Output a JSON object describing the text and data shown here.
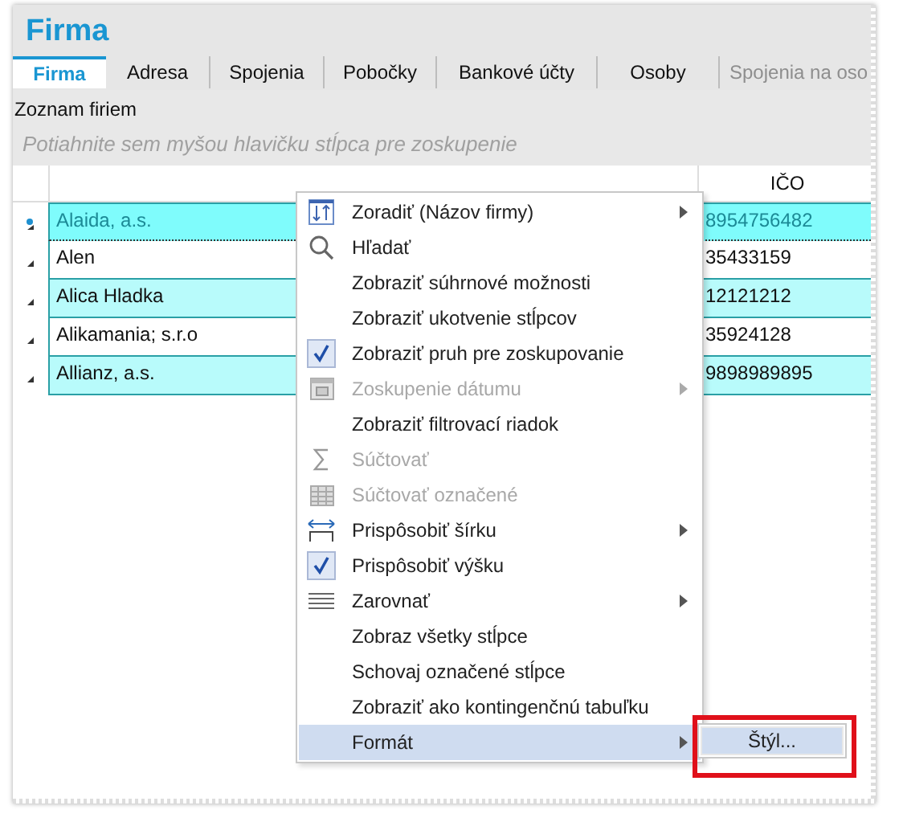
{
  "window": {
    "title": "Firma"
  },
  "tabs": [
    {
      "label": "Firma",
      "selected": true,
      "disabled": false
    },
    {
      "label": "Adresa",
      "selected": false,
      "disabled": false
    },
    {
      "label": "Spojenia",
      "selected": false,
      "disabled": false
    },
    {
      "label": "Pobočky",
      "selected": false,
      "disabled": false
    },
    {
      "label": "Bankové účty",
      "selected": false,
      "disabled": false
    },
    {
      "label": "Osoby",
      "selected": false,
      "disabled": false
    },
    {
      "label": "Spojenia na oso",
      "selected": false,
      "disabled": true
    }
  ],
  "section_title": "Zoznam firiem",
  "group_panel": {
    "hint": "Potiahnite sem myšou hlavičku stĺpca pre zoskupenie"
  },
  "table": {
    "columns": [
      "IČO"
    ],
    "rows": [
      {
        "name": "Alaida, a.s.",
        "ico": "8954756482",
        "selected": true
      },
      {
        "name": "Alen",
        "ico": "35433159",
        "selected": false
      },
      {
        "name": "Alica Hladka",
        "ico": "12121212",
        "selected": false
      },
      {
        "name": "Alikamania; s.r.o",
        "ico": "35924128",
        "selected": false
      },
      {
        "name": "Allianz, a.s.",
        "ico": "9898989895",
        "selected": false
      }
    ]
  },
  "context_menu": [
    {
      "label": "Zoradiť (Názov firmy)",
      "kind": "sort",
      "disabled": false,
      "submenu": true,
      "selected": false
    },
    {
      "label": "Hľadať",
      "kind": "search",
      "disabled": false,
      "submenu": false,
      "selected": false
    },
    {
      "label": "Zobraziť súhrnové možnosti",
      "kind": "plain",
      "disabled": false,
      "submenu": false,
      "selected": false
    },
    {
      "label": "Zobraziť ukotvenie stĺpcov",
      "kind": "plain",
      "disabled": false,
      "submenu": false,
      "selected": false
    },
    {
      "label": "Zobraziť pruh pre zoskupovanie",
      "kind": "toggle",
      "disabled": false,
      "submenu": false,
      "checked": true,
      "selected": false
    },
    {
      "label": "Zoskupenie dátumu",
      "kind": "calendar",
      "disabled": true,
      "submenu": true,
      "selected": false
    },
    {
      "label": "Zobraziť filtrovací riadok",
      "kind": "plain",
      "disabled": false,
      "submenu": false,
      "selected": false
    },
    {
      "label": "Súčtovať",
      "kind": "sum",
      "disabled": true,
      "submenu": false,
      "selected": false
    },
    {
      "label": "Súčtovať označené",
      "kind": "grid",
      "disabled": true,
      "submenu": false,
      "selected": false
    },
    {
      "label": "Prispôsobiť šírku",
      "kind": "width",
      "disabled": false,
      "submenu": true,
      "selected": false
    },
    {
      "label": "Prispôsobiť výšku",
      "kind": "toggle",
      "disabled": false,
      "submenu": false,
      "checked": true,
      "selected": false
    },
    {
      "label": "Zarovnať",
      "kind": "align",
      "disabled": false,
      "submenu": true,
      "selected": false
    },
    {
      "label": "Zobraz všetky stĺpce",
      "kind": "plain",
      "disabled": false,
      "submenu": false,
      "selected": false
    },
    {
      "label": "Schovaj označené stĺpce",
      "kind": "plain",
      "disabled": false,
      "submenu": false,
      "selected": false
    },
    {
      "label": "Zobraziť ako kontingenčnú tabuľku",
      "kind": "plain",
      "disabled": false,
      "submenu": false,
      "selected": false
    },
    {
      "label": "Formát",
      "kind": "plain",
      "disabled": false,
      "submenu": true,
      "selected": true
    }
  ],
  "submenu": [
    {
      "label": "Štýl...",
      "selected": true,
      "highlighted_frame": true
    }
  ]
}
